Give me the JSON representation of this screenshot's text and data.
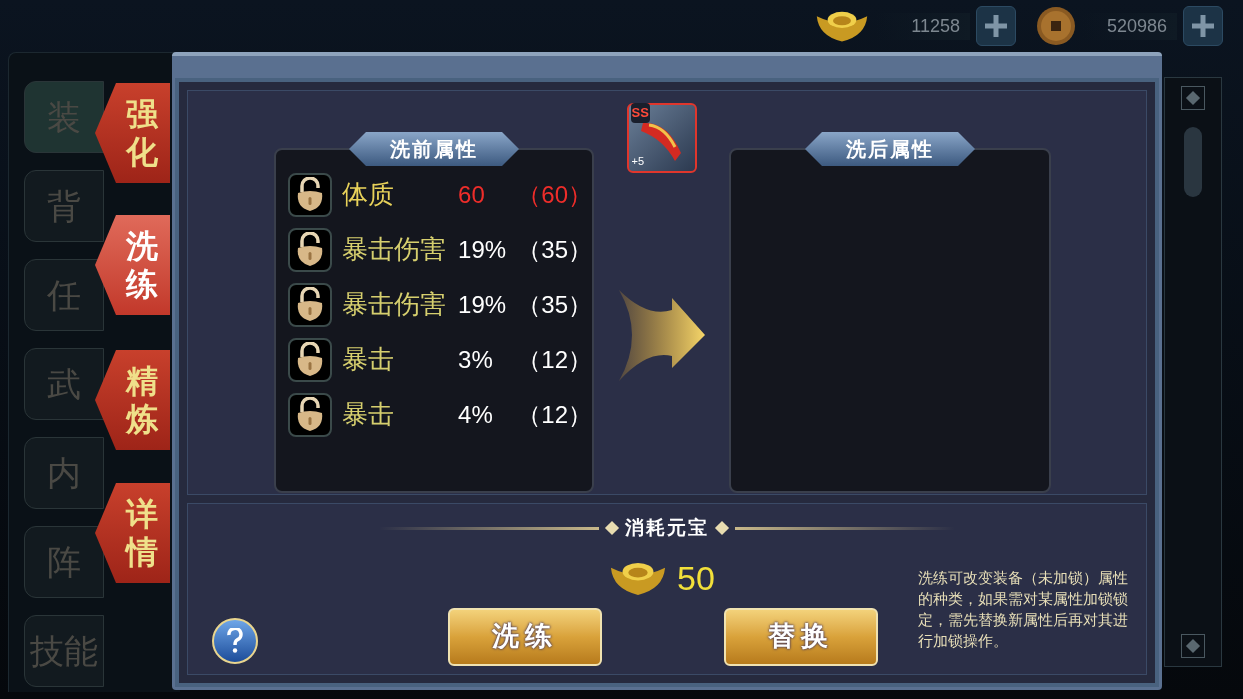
{
  "currencies": [
    {
      "kind": "ingot",
      "amount": "11258"
    },
    {
      "kind": "coin",
      "amount": "520986"
    }
  ],
  "side_menu": [
    {
      "label": "装",
      "selected": true
    },
    {
      "label": "背",
      "selected": false
    },
    {
      "label": "任",
      "selected": false
    },
    {
      "label": "武",
      "selected": false
    },
    {
      "label": "内",
      "selected": false
    },
    {
      "label": "阵",
      "selected": false
    },
    {
      "label": "技能",
      "selected": false
    }
  ],
  "tabs": [
    {
      "label": "强化",
      "selected": false
    },
    {
      "label": "洗练",
      "selected": true
    },
    {
      "label": "精炼",
      "selected": false
    },
    {
      "label": "详情",
      "selected": false
    }
  ],
  "before_panel": {
    "title": "洗前属性",
    "attributes": [
      {
        "name": "体质",
        "value": "60",
        "base": "（60）",
        "highlight": true
      },
      {
        "name": "暴击伤害",
        "value": "19%",
        "base": "（35）",
        "highlight": false
      },
      {
        "name": "暴击伤害",
        "value": "19%",
        "base": "（35）",
        "highlight": false
      },
      {
        "name": "暴击",
        "value": "3%",
        "base": "（12）",
        "highlight": false
      },
      {
        "name": "暴击",
        "value": "4%",
        "base": "（12）",
        "highlight": false
      }
    ]
  },
  "item": {
    "grade": "SS",
    "enhance": "+5"
  },
  "after_panel": {
    "title": "洗后属性"
  },
  "cost": {
    "title": "消耗元宝",
    "amount": "50"
  },
  "buttons": [
    "洗练",
    "替换"
  ],
  "note": "洗练可改变装备（未加锁）属性的种类，如果需对某属性加锁锁定，需先替换新属性后再对其进行加锁操作。"
}
